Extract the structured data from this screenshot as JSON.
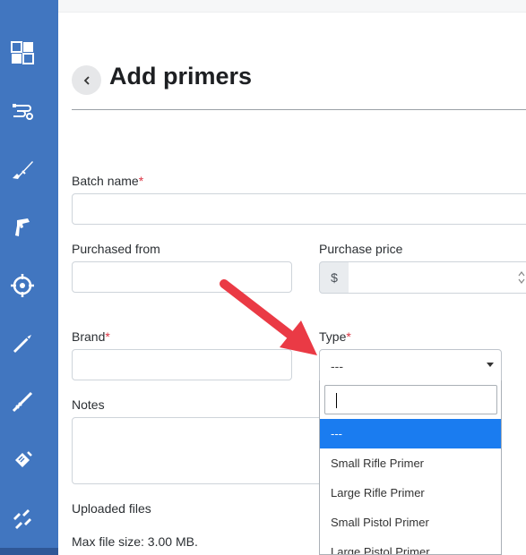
{
  "page": {
    "title": "Add primers"
  },
  "colors": {
    "sidebar": "#4176c0",
    "accent_selected": "#1a7cf0",
    "required": "#dc3545",
    "annotation_arrow": "#ea3a45"
  },
  "sidebar": {
    "items": [
      {
        "icon": "dashboard-icon"
      },
      {
        "icon": "components-icon"
      },
      {
        "icon": "rifle-icon"
      },
      {
        "icon": "pistol-icon"
      },
      {
        "icon": "target-icon"
      },
      {
        "icon": "cartridge-icon"
      },
      {
        "icon": "cleaning-rod-icon"
      },
      {
        "icon": "ammo-box-icon"
      },
      {
        "icon": "bullets-icon"
      }
    ]
  },
  "form": {
    "batch_name": {
      "label": "Batch name",
      "required_mark": "*",
      "value": ""
    },
    "purchased_from": {
      "label": "Purchased from",
      "value": ""
    },
    "purchase_price": {
      "label": "Purchase price",
      "prefix": "$",
      "value": ""
    },
    "brand": {
      "label": "Brand",
      "required_mark": "*",
      "value": ""
    },
    "type": {
      "label": "Type",
      "required_mark": "*",
      "selected": "---",
      "search_value": "",
      "options": [
        "---",
        "Small Rifle Primer",
        "Large Rifle Primer",
        "Small Pistol Primer",
        "Large Pistol Primer"
      ],
      "highlighted_index": 0
    },
    "notes": {
      "label": "Notes",
      "value": ""
    },
    "uploaded_files": {
      "label": "Uploaded files"
    },
    "max_file_size": "Max file size: 3.00 MB."
  }
}
